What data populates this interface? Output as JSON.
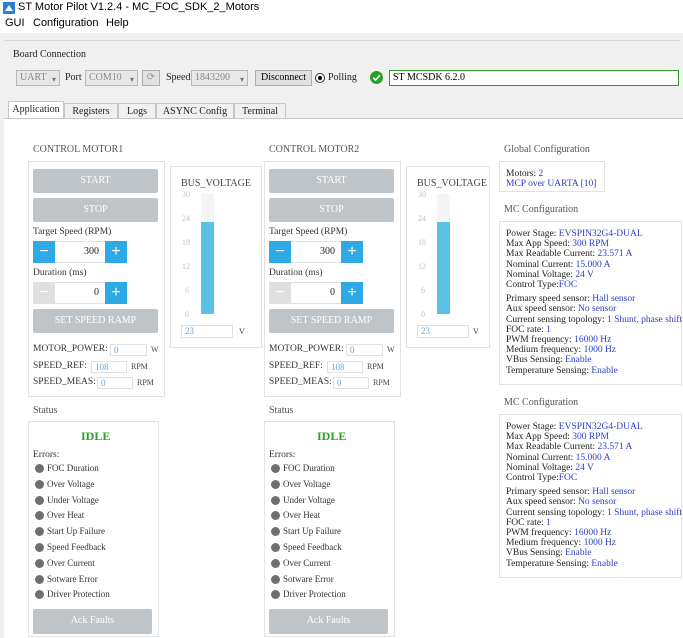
{
  "window": {
    "title": "ST Motor Pilot V1.2.4 - MC_FOC_SDK_2_Motors"
  },
  "menu": [
    "GUI",
    "Configuration",
    "Help"
  ],
  "board_connection": {
    "title": "Board Connection",
    "interface_value": "UART",
    "port_label": "Port",
    "port_value": "COM10",
    "speed_label": "Speed",
    "speed_value": "1843200",
    "disconnect_label": "Disconnect",
    "polling_label": "Polling",
    "firmware": "ST MCSDK 6.2.0"
  },
  "tabs": [
    "Application",
    "Registers",
    "Logs",
    "ASYNC Config",
    "Terminal"
  ],
  "motors": [
    {
      "title": "CONTROL MOTOR1",
      "start_label": "START",
      "stop_label": "STOP",
      "target_speed_label": "Target Speed (RPM)",
      "target_speed": "300",
      "duration_label": "Duration (ms)",
      "duration": "0",
      "ramp_label": "SET SPEED RAMP",
      "motor_power_label": "MOTOR_POWER:",
      "motor_power": "0",
      "motor_power_unit": "W",
      "speed_ref_label": "SPEED_REF:",
      "speed_ref": "108",
      "speed_ref_unit": "RPM",
      "speed_meas_label": "SPEED_MEAS:",
      "speed_meas": "0",
      "speed_meas_unit": "RPM",
      "bus_title": "BUS_VOLTAGE",
      "bus_ticks": [
        "30",
        "24",
        "18",
        "12",
        "6",
        "0"
      ],
      "bus_value": "23",
      "bus_unit": "V",
      "bus_fill_fraction": 0.77
    },
    {
      "title": "CONTROL MOTOR2",
      "start_label": "START",
      "stop_label": "STOP",
      "target_speed_label": "Target Speed (RPM)",
      "target_speed": "300",
      "duration_label": "Duration (ms)",
      "duration": "0",
      "ramp_label": "SET SPEED RAMP",
      "motor_power_label": "MOTOR_POWER:",
      "motor_power": "0",
      "motor_power_unit": "W",
      "speed_ref_label": "SPEED_REF:",
      "speed_ref": "108",
      "speed_ref_unit": "RPM",
      "speed_meas_label": "SPEED_MEAS:",
      "speed_meas": "0",
      "speed_meas_unit": "RPM",
      "bus_title": "BUS_VOLTAGE",
      "bus_ticks": [
        "30",
        "24",
        "18",
        "12",
        "6",
        "0"
      ],
      "bus_value": "23",
      "bus_unit": "V",
      "bus_fill_fraction": 0.77
    }
  ],
  "status": [
    {
      "title": "Status",
      "state": "IDLE",
      "errors_label": "Errors:",
      "errors": [
        "FOC Duration",
        "Over Voltage",
        "Under Voltage",
        "Over Heat",
        "Start Up Failure",
        "Speed Feedback",
        "Over Current",
        "Sotware Error",
        "Driver Protection"
      ],
      "ack_label": "Ack Faults"
    },
    {
      "title": "Status",
      "state": "IDLE",
      "errors_label": "Errors:",
      "errors": [
        "FOC Duration",
        "Over Voltage",
        "Under Voltage",
        "Over Heat",
        "Start Up Failure",
        "Speed Feedback",
        "Over Current",
        "Sotware Error",
        "Driver Protection"
      ],
      "ack_label": "Ack Faults"
    }
  ],
  "global_config": {
    "title": "Global Configuration",
    "motors_label": "Motors:",
    "motors_value": "2",
    "mcp_value": "MCP over UARTA [10]"
  },
  "mc_config": [
    {
      "title": "MC Configuration",
      "lines": [
        {
          "label": "Power Stage: ",
          "value": "EVSPIN32G4-DUAL"
        },
        {
          "label": "Max App Speed: ",
          "value": "300 RPM"
        },
        {
          "label": "Max Readable Current: ",
          "value": "23.571 A"
        },
        {
          "label": "Nominal Current: ",
          "value": "15.000 A"
        },
        {
          "label": "Nominal Voltage: ",
          "value": "24 V"
        },
        {
          "label": "Control Type:",
          "value": "FOC"
        },
        {
          "label": "Primary speed sensor: ",
          "value": "Hall sensor"
        },
        {
          "label": "Aux speed sensor: ",
          "value": "No sensor"
        },
        {
          "label": "Current sensing topology: ",
          "value": "1 Shunt, phase shift"
        },
        {
          "label": "FOC rate: ",
          "value": "1"
        },
        {
          "label": "PWM frequency: ",
          "value": "16000 Hz"
        },
        {
          "label": "Medium frequency: ",
          "value": "1000 Hz"
        },
        {
          "label": "VBus Sensing: ",
          "value": "Enable"
        },
        {
          "label": "Temperature Sensing: ",
          "value": "Enable"
        }
      ]
    },
    {
      "title": "MC Configuration",
      "lines": [
        {
          "label": "Power Stage: ",
          "value": "EVSPIN32G4-DUAL"
        },
        {
          "label": "Max App Speed: ",
          "value": "300 RPM"
        },
        {
          "label": "Max Readable Current: ",
          "value": "23.571 A"
        },
        {
          "label": "Nominal Current: ",
          "value": "15.000 A"
        },
        {
          "label": "Nominal Voltage: ",
          "value": "24 V"
        },
        {
          "label": "Control Type:",
          "value": "FOC"
        },
        {
          "label": "Primary speed sensor: ",
          "value": "Hall sensor"
        },
        {
          "label": "Aux speed sensor: ",
          "value": "No sensor"
        },
        {
          "label": "Current sensing topology: ",
          "value": "1 Shunt, phase shift"
        },
        {
          "label": "FOC rate: ",
          "value": "1"
        },
        {
          "label": "PWM frequency: ",
          "value": "16000 Hz"
        },
        {
          "label": "Medium frequency: ",
          "value": "1000 Hz"
        },
        {
          "label": "VBus Sensing: ",
          "value": "Enable"
        },
        {
          "label": "Temperature Sensing: ",
          "value": "Enable"
        }
      ]
    }
  ],
  "colors": {
    "accent": "#2ea9e6",
    "idle": "#2aa02a",
    "value_blue": "#2a3fc4",
    "gauge_fill": "#5bc0e5"
  }
}
